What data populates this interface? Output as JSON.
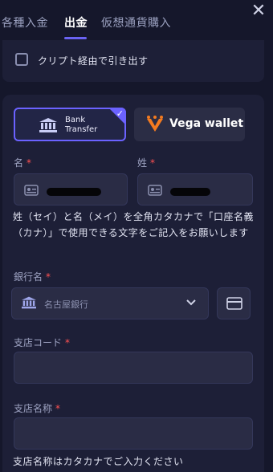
{
  "tabs": [
    {
      "label": "各種入金",
      "active": false
    },
    {
      "label": "出金",
      "active": true
    },
    {
      "label": "仮想通貨購入",
      "active": false
    }
  ],
  "close_icon": "close-icon",
  "crypto_option": {
    "label": "クリプト経由で引き出す",
    "checked": false
  },
  "methods": {
    "bank": {
      "label": "Bank\nTransfer",
      "selected": true
    },
    "vega": {
      "label": "Vega wallet",
      "selected": false
    }
  },
  "fields": {
    "first_name": {
      "label": "名",
      "required": "*"
    },
    "last_name": {
      "label": "姓",
      "required": "*"
    },
    "bank_name": {
      "label": "銀行名",
      "required": "*",
      "value": "名古屋銀行"
    },
    "branch_code": {
      "label": "支店コード",
      "required": "*",
      "value": ""
    },
    "branch_name": {
      "label": "支店名称",
      "required": "*",
      "value": ""
    }
  },
  "notes": {
    "name_kana": "姓（セイ）と名（メイ）を全角カタカナで「口座名義（カナ）」で使用できる文字をご記入をお願いします",
    "branch_kana": "支店名称はカタカナでご入力ください"
  },
  "colors": {
    "accent": "#6b62ff",
    "required": "#ff5252",
    "vega_orange": "#f47b20"
  }
}
